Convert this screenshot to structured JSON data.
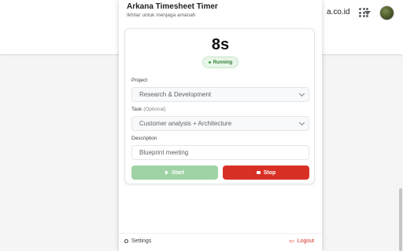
{
  "background": {
    "email_fragment": "a.co.id",
    "icons": [
      "apps-grid-icon",
      "account-avatar"
    ]
  },
  "popup": {
    "title": "Arkana Timesheet Timer",
    "subtitle": "Ikhtiar untuk menjaga amanah",
    "timer": "8s",
    "status": "Running",
    "project_label": "Project",
    "project_value": "Research & Development",
    "task_label": "Task",
    "task_optional": "(Optional)",
    "task_value": "Customer analysis + Architecture",
    "description_label": "Description",
    "description_placeholder": "Blueprint meeting",
    "start_label": "Start",
    "stop_label": "Stop",
    "settings_label": "Settings",
    "logout_label": "Logout",
    "colors": {
      "start": "#9fd3a5",
      "stop": "#d93025",
      "status_bg": "#e8f5e9",
      "status_text": "#2e7d32"
    }
  }
}
